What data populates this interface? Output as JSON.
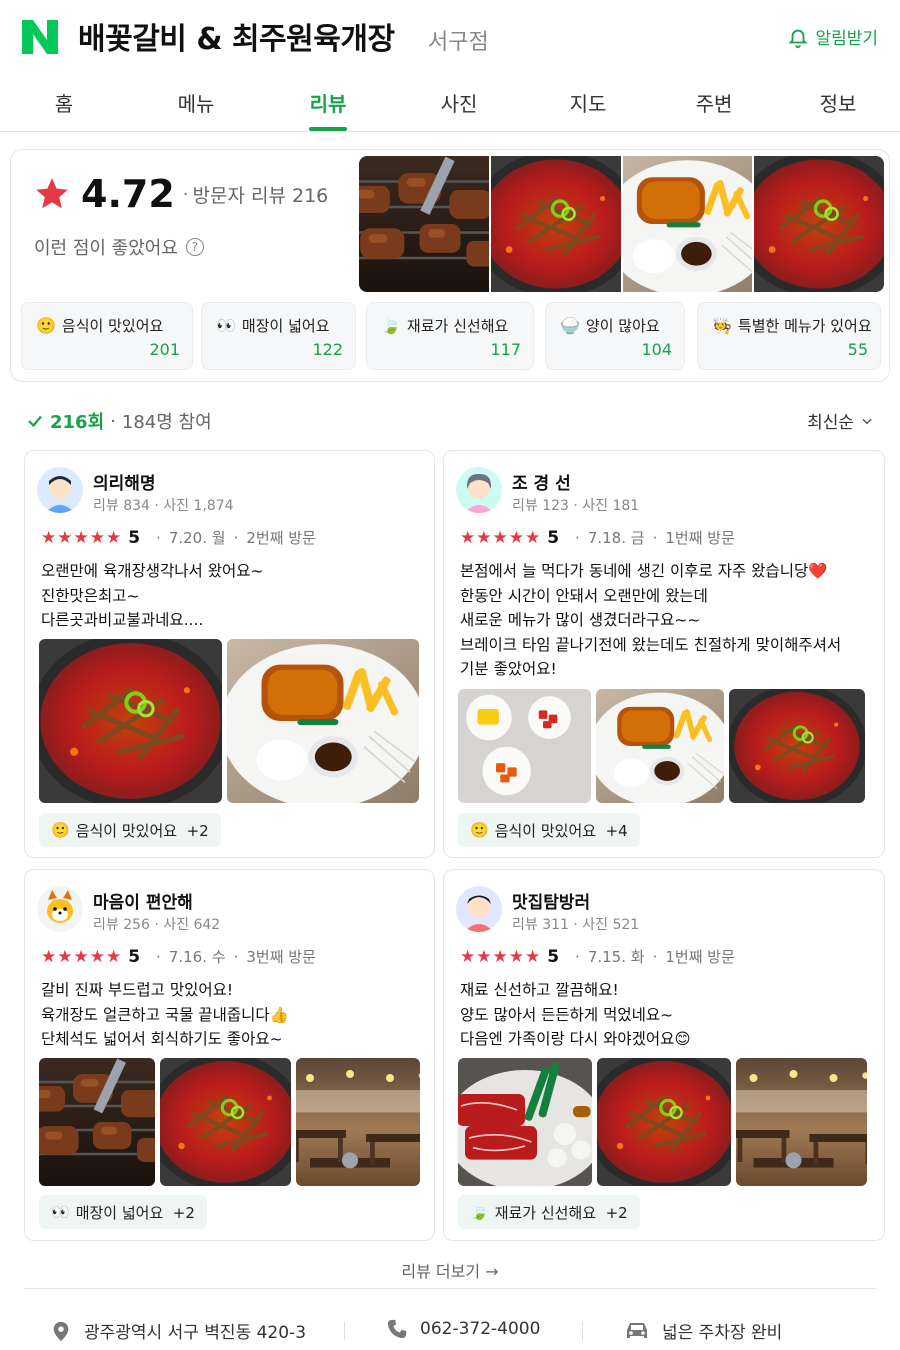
{
  "header": {
    "title": "배꽃갈비 & 최주원육개장",
    "branch": "서구점",
    "alarm_label": "알림받기"
  },
  "tabs": [
    "홈",
    "메뉴",
    "리뷰",
    "사진",
    "지도",
    "주변",
    "정보"
  ],
  "active_tab": "리뷰",
  "summary": {
    "rating": "4.72",
    "sep": "·",
    "visitor_reviews": "방문자 리뷰 216",
    "likes_prompt": "이런 점이 좋았어요",
    "help": "?",
    "photos": [
      "grilled-galbi",
      "yukgaejang",
      "pork-cutlet",
      "yukgaejang"
    ],
    "keywords": [
      {
        "icon": "smile-emoji-icon",
        "label": "음식이 맛있어요",
        "count": "201"
      },
      {
        "icon": "eyes-emoji-icon",
        "label": "매장이 넓어요",
        "count": "122"
      },
      {
        "icon": "leaf-icon",
        "label": "재료가 신선해요",
        "count": "117"
      },
      {
        "icon": "rice-bowl-icon",
        "label": "양이 많아요",
        "count": "104"
      },
      {
        "icon": "chef-icon",
        "label": "특별한 메뉴가 있어요",
        "count": "55"
      }
    ]
  },
  "review_count": {
    "count": "216회",
    "sep": "·",
    "participants": "184명 참여",
    "sort": "최신순"
  },
  "reviews": [
    {
      "name": "의리해명",
      "stats": "리뷰 834 · 사진 1,874",
      "stars": "★★★★★",
      "score": "5",
      "date": "7.20. 월",
      "visit": "2번째 방문",
      "lines": [
        "오랜만에 육개장생각나서 왔어요~",
        "진한맛은최고~",
        "다른곳과비교불과네요...."
      ],
      "photos": [
        "yukgaejang",
        "pork-cutlet"
      ],
      "chip": "음식이 맛있어요  +2",
      "chip_icon": "smile-emoji-icon"
    },
    {
      "name": "조 경 선",
      "stats": "리뷰 123 · 사진 181",
      "stars": "★★★★★",
      "score": "5",
      "date": "7.18. 금",
      "visit": "1번째 방문",
      "lines": [
        "본점에서 늘 먹다가 동네에 생긴 이후로 자주 왔습니당❤️",
        "한동안 시간이 안돼서 오랜만에 왔는데",
        "새로운 메뉴가 많이 생겼더라구요~~",
        "브레이크 타임 끝나기전에 왔는데도 친절하게 맞이해주셔서",
        "기분 좋았어요!"
      ],
      "photos": [
        "side-dishes",
        "pork-cutlet",
        "yukgaejang"
      ],
      "chip": "음식이 맛있어요  +4",
      "chip_icon": "smile-emoji-icon"
    },
    {
      "name": "마음이 편안해",
      "stats": "리뷰 256 · 사진 642",
      "stars": "★★★★★",
      "score": "5",
      "date": "7.16. 수",
      "visit": "3번째 방문",
      "lines": [
        "갈비 진짜 부드럽고 맛있어요!",
        "육개장도 얼큰하고 국물 끝내줍니다👍",
        "단체석도 넓어서 회식하기도 좋아요~"
      ],
      "photos": [
        "grilled-galbi",
        "yukgaejang",
        "restaurant-interior"
      ],
      "chip": "매장이 넓어요  +2",
      "chip_icon": "eyes-emoji-icon"
    },
    {
      "name": "맛집탐방러",
      "stats": "리뷰 311 · 사진 521",
      "stars": "★★★★★",
      "score": "5",
      "date": "7.15. 화",
      "visit": "1번째 방문",
      "lines": [
        "재료 신선하고 깔끔해요!",
        "양도 많아서 든든하게 먹었네요~",
        "다음엔 가족이랑 다시 와야겠어요😊"
      ],
      "photos": [
        "raw-beef",
        "yukgaejang",
        "restaurant-interior"
      ],
      "chip": "재료가 신선해요  +2",
      "chip_icon": "leaf-icon"
    }
  ],
  "more_reviews": "리뷰 더보기 →",
  "footer": {
    "address": "광주광역시 서구 벽진동 420-3",
    "phone": "062-372-4000",
    "parking": "넓은 주차장 완비"
  },
  "colors": {
    "accent": "#16a34a",
    "star": "#e63946",
    "naver": "#03c75a"
  }
}
